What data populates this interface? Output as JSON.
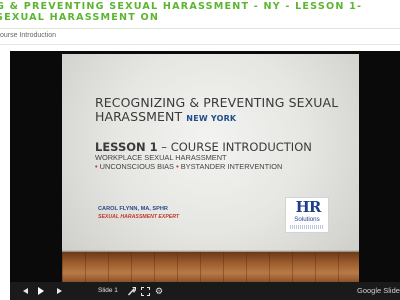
{
  "course_header": {
    "title": "G & PREVENTING SEXUAL HARASSMENT - NY - LESSON 1- SEXUAL HARASSMENT ON"
  },
  "breadcrumb": {
    "text": "ourse Introduction"
  },
  "slide": {
    "title": "RECOGNIZING & PREVENTING SEXUAL HARASSMENT",
    "state": "NEW YORK",
    "lesson_bold": "LESSON 1",
    "lesson_rest": " – COURSE INTRODUCTION",
    "subtitle": "WORKPLACE SEXUAL HARASSMENT",
    "topic_1": "UNCONSCIOUS BIAS",
    "topic_2": "BYSTANDER INTERVENTION",
    "bullet": "•",
    "presenter_name": "CAROL FLYNN, MA, SPHR",
    "presenter_role": "SEXUAL HARASSMENT EXPERT",
    "logo_text": "HR",
    "logo_sub": "Solutions"
  },
  "controls": {
    "slide_selector_value": "Slide 1",
    "brand_label": "Google Slide"
  },
  "icons": {
    "prev": "previous-slide-icon",
    "play": "play-icon",
    "next": "next-slide-icon",
    "pointer": "laser-pointer-icon",
    "fullscreen": "fullscreen-icon",
    "settings": "gear-icon"
  },
  "colors": {
    "header_green": "#5cb531",
    "slide_navy": "#1f4e8c",
    "accent_red": "#c0392b",
    "player_bg": "#0a0a0a"
  }
}
